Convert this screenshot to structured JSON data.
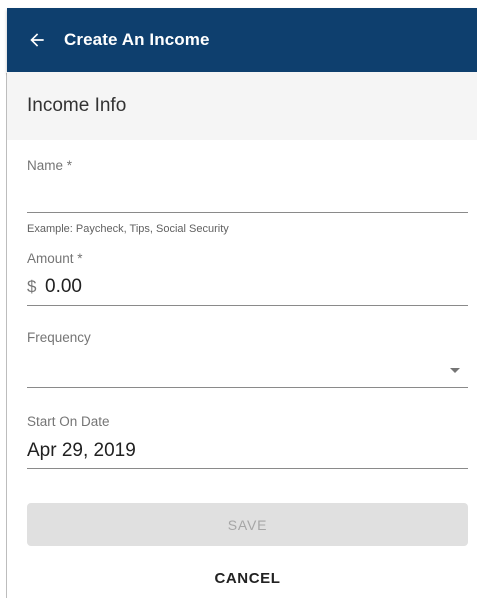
{
  "header": {
    "back_icon": "arrow-back-icon",
    "title": "Create An Income"
  },
  "section": {
    "title": "Income Info"
  },
  "form": {
    "name": {
      "label": "Name *",
      "value": "",
      "helper": "Example: Paycheck, Tips, Social Security"
    },
    "amount": {
      "label": "Amount *",
      "currency": "$",
      "value": "0.00"
    },
    "frequency": {
      "label": "Frequency",
      "value": "",
      "dropdown_icon": "arrow-drop-down-icon"
    },
    "start_date": {
      "label": "Start On Date",
      "value": "Apr 29, 2019"
    }
  },
  "actions": {
    "save_label": "SAVE",
    "cancel_label": "CANCEL"
  },
  "colors": {
    "appbar": "#0e3f6e",
    "section_bg": "#f5f5f5",
    "save_disabled_bg": "#e0e0e0"
  }
}
